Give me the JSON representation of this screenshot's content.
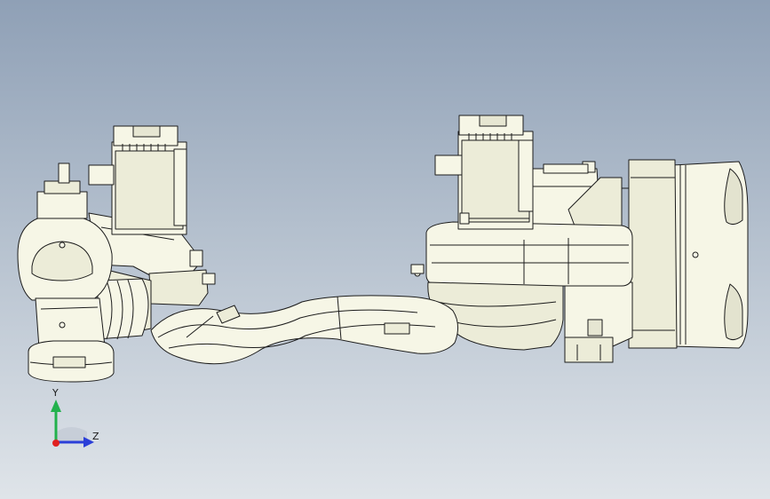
{
  "viewport": {
    "background_top": "#8fa0b6",
    "background_bottom": "#dfe4e9"
  },
  "model": {
    "body_color": "#f6f6e6",
    "shade_color": "#dcdcc6",
    "line_color": "#1c1c1c"
  },
  "triad": {
    "y_label": "Y",
    "z_label": "Z",
    "y_color": "#22b14c",
    "z_color": "#2b3fd8",
    "x_color": "#e02020"
  }
}
